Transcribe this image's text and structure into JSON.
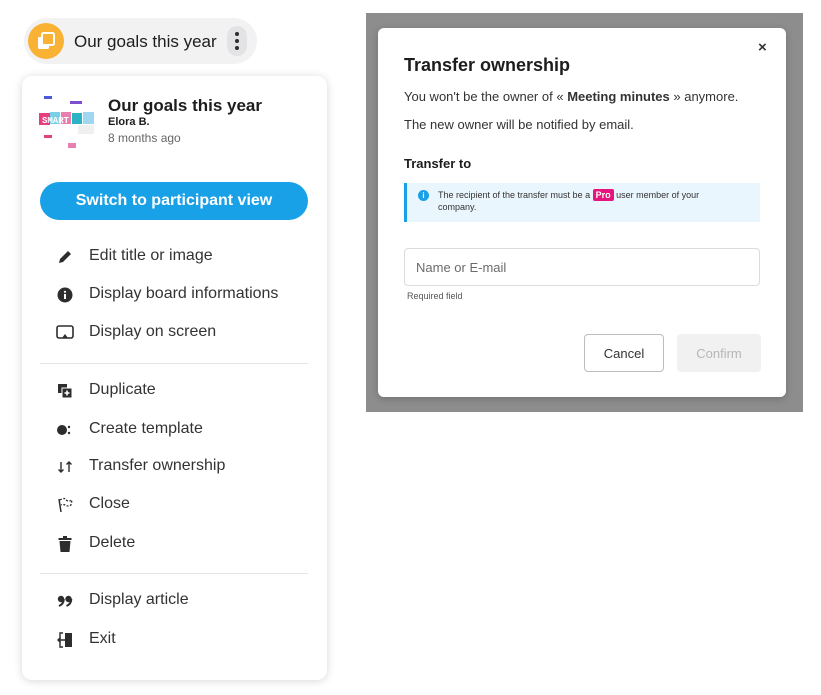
{
  "board": {
    "title": "Our goals this year",
    "author": "Elora B.",
    "time_ago": "8 months ago",
    "accent": "#f9b233"
  },
  "menu": {
    "switch_label": "Switch to participant view",
    "group1": [
      {
        "label": "Edit title or image",
        "icon": "pencil-icon"
      },
      {
        "label": "Display board informations",
        "icon": "info-icon"
      },
      {
        "label": "Display on screen",
        "icon": "screen-cast-icon"
      }
    ],
    "group2": [
      {
        "label": "Duplicate",
        "icon": "duplicate-icon"
      },
      {
        "label": "Create template",
        "icon": "template-icon"
      },
      {
        "label": "Transfer ownership",
        "icon": "transfer-arrows-icon"
      },
      {
        "label": "Close",
        "icon": "close-board-icon"
      },
      {
        "label": "Delete",
        "icon": "trash-icon"
      }
    ],
    "group3": [
      {
        "label": "Display article",
        "icon": "quote-icon"
      },
      {
        "label": "Exit",
        "icon": "exit-icon"
      }
    ]
  },
  "modal": {
    "title": "Transfer ownership",
    "line1_prefix": "You won't be the owner of « ",
    "line1_board": "Meeting minutes",
    "line1_suffix": " » anymore.",
    "line2": "The new owner will be notified by email.",
    "transfer_to": "Transfer to",
    "notice_prefix": "The recipient of the transfer must be a ",
    "notice_badge": "Pro",
    "notice_suffix": " user member of your company.",
    "input_placeholder": "Name or E-mail",
    "input_value": "",
    "required": "Required field",
    "cancel": "Cancel",
    "confirm": "Confirm",
    "close_symbol": "×"
  },
  "colors": {
    "primary": "#19a1e8",
    "pro": "#e6157d",
    "overlay": "#8d8d8d"
  }
}
